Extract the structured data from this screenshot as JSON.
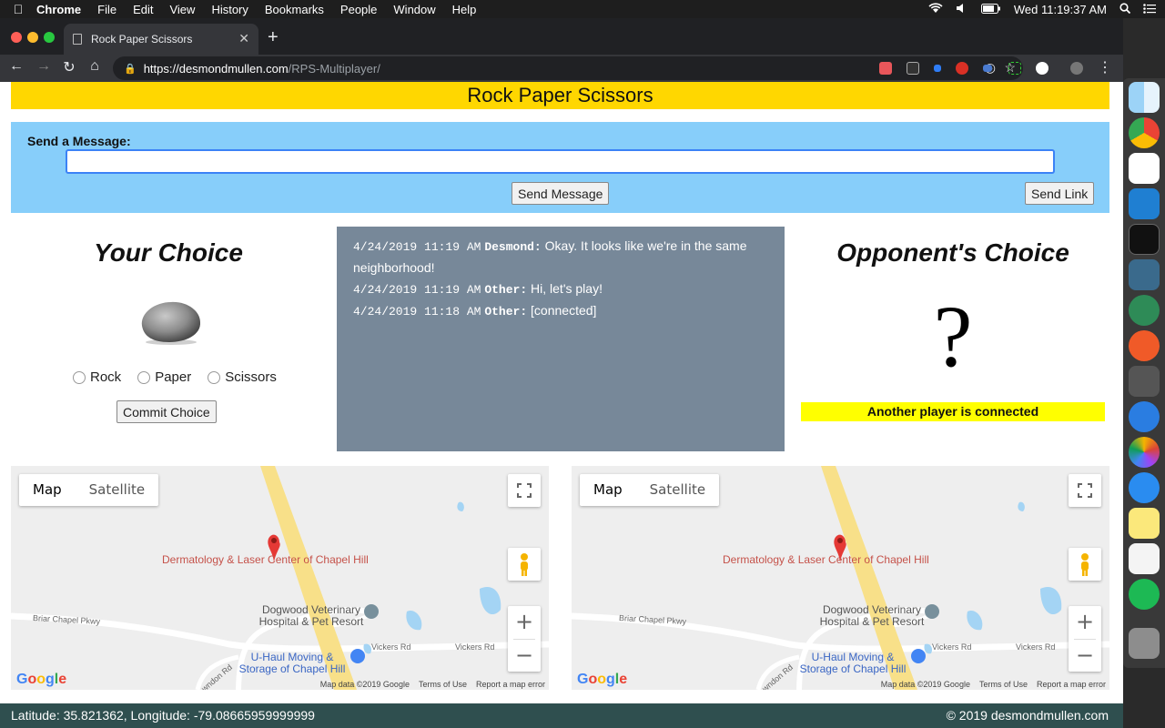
{
  "menubar": {
    "app": "Chrome",
    "items": [
      "File",
      "Edit",
      "View",
      "History",
      "Bookmarks",
      "People",
      "Window",
      "Help"
    ],
    "clock": "Wed 11:19:37 AM"
  },
  "browser": {
    "tab_title": "Rock Paper Scissors",
    "url_host": "https://desmondmullen.com",
    "url_path": "/RPS-Multiplayer/"
  },
  "page": {
    "title": "Rock Paper Scissors",
    "message": {
      "label": "Send a Message:",
      "input_value": "",
      "send_button": "Send Message",
      "link_button": "Send Link"
    },
    "your_choice": {
      "title": "Your Choice",
      "options": [
        "Rock",
        "Paper",
        "Scissors"
      ],
      "commit_button": "Commit Choice"
    },
    "chat": [
      {
        "time": "4/24/2019 11:19 AM",
        "who": "Desmond:",
        "text": "Okay. It looks like we're in the same neighborhood!"
      },
      {
        "time": "4/24/2019 11:19 AM",
        "who": "Other:",
        "text": "Hi, let's play!"
      },
      {
        "time": "4/24/2019 11:18 AM",
        "who": "Other:",
        "text": "[connected]"
      }
    ],
    "opponent": {
      "title": "Opponent's Choice",
      "mark": "?",
      "status": "Another player is connected"
    },
    "map": {
      "type_map": "Map",
      "type_satellite": "Satellite",
      "place_1": "Dermatology & Laser Center of Chapel Hill",
      "place_2": "Dogwood Veterinary Hospital & Pet Resort",
      "place_3": "U-Haul Moving & Storage of Chapel Hill",
      "road_1": "Briar Chapel Pkwy",
      "road_2": "Vickers Rd",
      "road_3": "Vickers Rd",
      "road_4": "wndon Rd",
      "google": "Google",
      "attrib_data": "Map data ©2019 Google",
      "attrib_terms": "Terms of Use",
      "attrib_report": "Report a map error"
    },
    "footer": {
      "coords": "Latitude: 35.821362, Longitude: -79.08665959999999",
      "copyright": "© 2019 desmondmullen.com"
    }
  }
}
